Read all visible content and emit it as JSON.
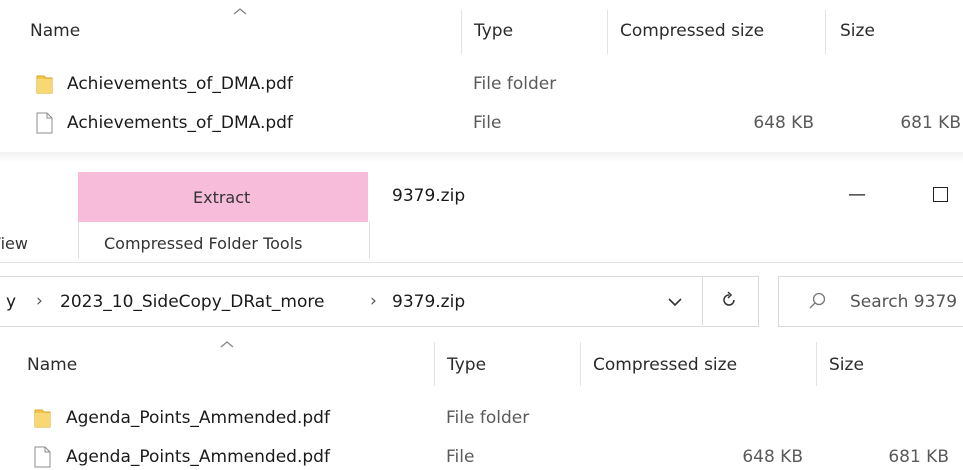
{
  "top_list": {
    "columns": {
      "name": "Name",
      "type": "Type",
      "compressed_size": "Compressed size",
      "size": "Size"
    },
    "rows": [
      {
        "icon": "folder-icon",
        "name": "Achievements_of_DMA.pdf",
        "type": "File folder",
        "compressed_size": "",
        "size": ""
      },
      {
        "icon": "file-icon",
        "name": "Achievements_of_DMA.pdf",
        "type": "File",
        "compressed_size": "648 KB",
        "size": "681 KB"
      }
    ]
  },
  "ribbon": {
    "extract_tab": "Extract",
    "window_title": "9379.zip",
    "view_tab": "View",
    "compressed_tools_tab": "Compressed Folder Tools",
    "minimize_glyph": "—",
    "maximize_glyph": "☐",
    "extract_bg": "#f6bcd9"
  },
  "address": {
    "crumb_partial": "y",
    "crumb_sep": "›",
    "crumb_folder": "2023_10_SideCopy_DRat_more",
    "crumb_current": "9379.zip",
    "dropdown_glyph": "⌄",
    "refresh_glyph": "↻",
    "search_placeholder": "Search 9379"
  },
  "bottom_list": {
    "columns": {
      "name": "Name",
      "type": "Type",
      "compressed_size": "Compressed size",
      "size": "Size"
    },
    "rows": [
      {
        "icon": "folder-icon",
        "name": "Agenda_Points_Ammended.pdf",
        "type": "File folder",
        "compressed_size": "",
        "size": ""
      },
      {
        "icon": "file-icon",
        "name": "Agenda_Points_Ammended.pdf",
        "type": "File",
        "compressed_size": "648 KB",
        "size": "681 KB"
      }
    ]
  }
}
